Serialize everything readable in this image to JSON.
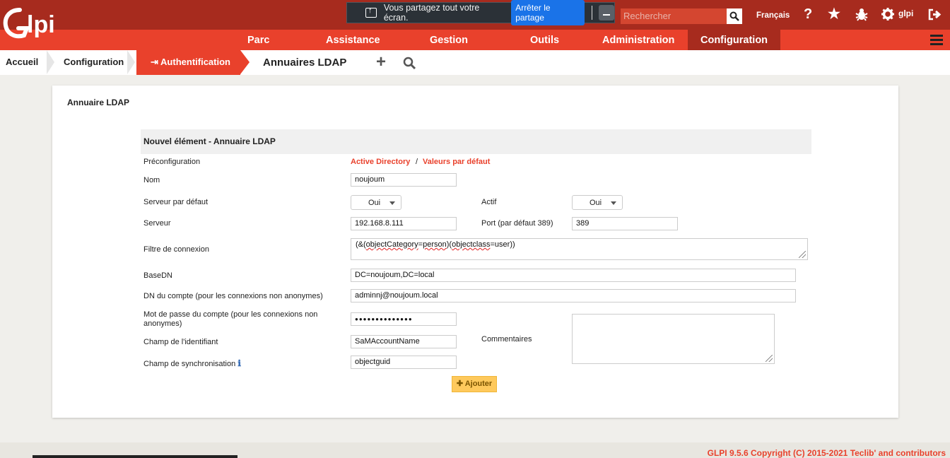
{
  "header": {
    "logo_text": "Glpi",
    "share": {
      "message": "Vous partagez tout votre écran.",
      "stop_label": "Arrêter le partage"
    },
    "search_placeholder": "Rechercher",
    "language": "Français",
    "user": "glpi",
    "icons": [
      "help-icon",
      "star-icon",
      "bug-icon",
      "gear-icon",
      "logout-icon"
    ]
  },
  "menu": {
    "items": [
      "Parc",
      "Assistance",
      "Gestion",
      "Outils",
      "Administration",
      "Configuration"
    ],
    "active": "Configuration"
  },
  "breadcrumb": {
    "items": [
      "Accueil",
      "Configuration"
    ],
    "active": "Authentification",
    "title": "Annuaires LDAP"
  },
  "card": {
    "title": "Annuaire LDAP",
    "form_header": "Nouvel élément - Annuaire LDAP",
    "labels": {
      "preconfig": "Préconfiguration",
      "nom": "Nom",
      "serveur_defaut": "Serveur par défaut",
      "actif": "Actif",
      "serveur": "Serveur",
      "port": "Port (par défaut 389)",
      "filtre": "Filtre de connexion",
      "basedn": "BaseDN",
      "dn_compte": "DN du compte (pour les connexions non anonymes)",
      "mdp_line1": "Mot de passe du compte (pour les connexions non",
      "mdp_line2": "anonymes)",
      "commentaires": "Commentaires",
      "champ_identifiant": "Champ de l'identifiant",
      "champ_sync": "Champ de synchronisation"
    },
    "preconfig_links": {
      "ad": "Active Directory",
      "sep": "/",
      "defaults": "Valeurs par défaut"
    },
    "values": {
      "nom": "noujoum",
      "serveur_defaut": "Oui",
      "actif": "Oui",
      "serveur": "192.168.8.111",
      "port": "389",
      "filtre_pre": "(&(",
      "filtre_w1": "objectCategory",
      "filtre_mid1": "=",
      "filtre_w2": "person",
      "filtre_mid2": ")(",
      "filtre_w3": "objectclass",
      "filtre_post": "=user))",
      "basedn": "DC=noujoum,DC=local",
      "dn_compte": "adminnj@noujoum.local",
      "mdp": "●●●●●●●●●●●●●●",
      "commentaires": "",
      "champ_identifiant": "SaMAccountName",
      "champ_sync": "objectguid"
    },
    "add_label": "Ajouter"
  },
  "footer": {
    "text": "GLPI 9.5.6 Copyright (C) 2015-2021 Teclib' and contributors"
  }
}
